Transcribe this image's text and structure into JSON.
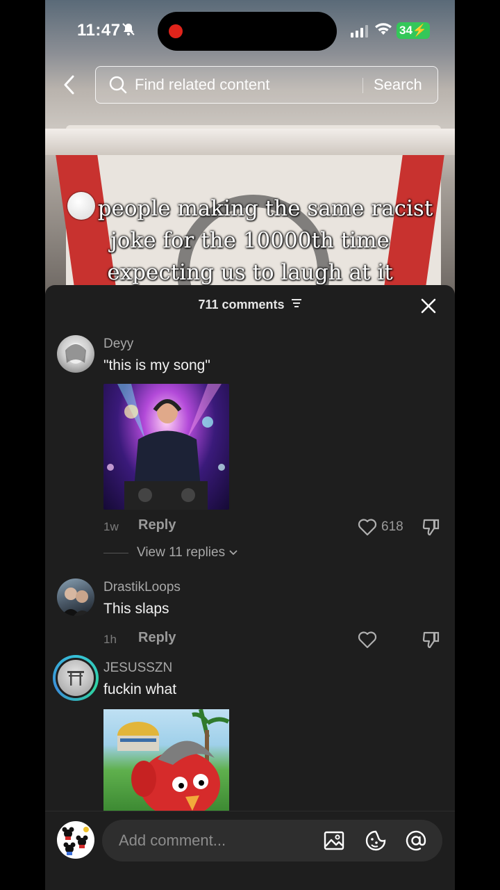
{
  "status_bar": {
    "time": "11:47",
    "battery": "34"
  },
  "search": {
    "placeholder": "Find related content",
    "button_label": "Search"
  },
  "video": {
    "caption": "people making the same racist joke for the 10000th time expecting us to laugh at it"
  },
  "comments_panel": {
    "count_label": "711 comments",
    "comments": [
      {
        "username": "Deyy",
        "text": "\"this is my song\"",
        "age": "1w",
        "reply_label": "Reply",
        "likes": "618",
        "view_replies": "View 11 replies"
      },
      {
        "username": "DrastikLoops",
        "text": "This slaps",
        "age": "1h",
        "reply_label": "Reply",
        "likes": ""
      },
      {
        "username": "JESUSSZN",
        "text": "fuckin what"
      }
    ]
  },
  "composer": {
    "placeholder": "Add comment..."
  },
  "colors": {
    "panel_bg": "#1e1e1e",
    "battery_green": "#34c759",
    "record_red": "#e0241b",
    "story_ring": "#36c0d8"
  }
}
